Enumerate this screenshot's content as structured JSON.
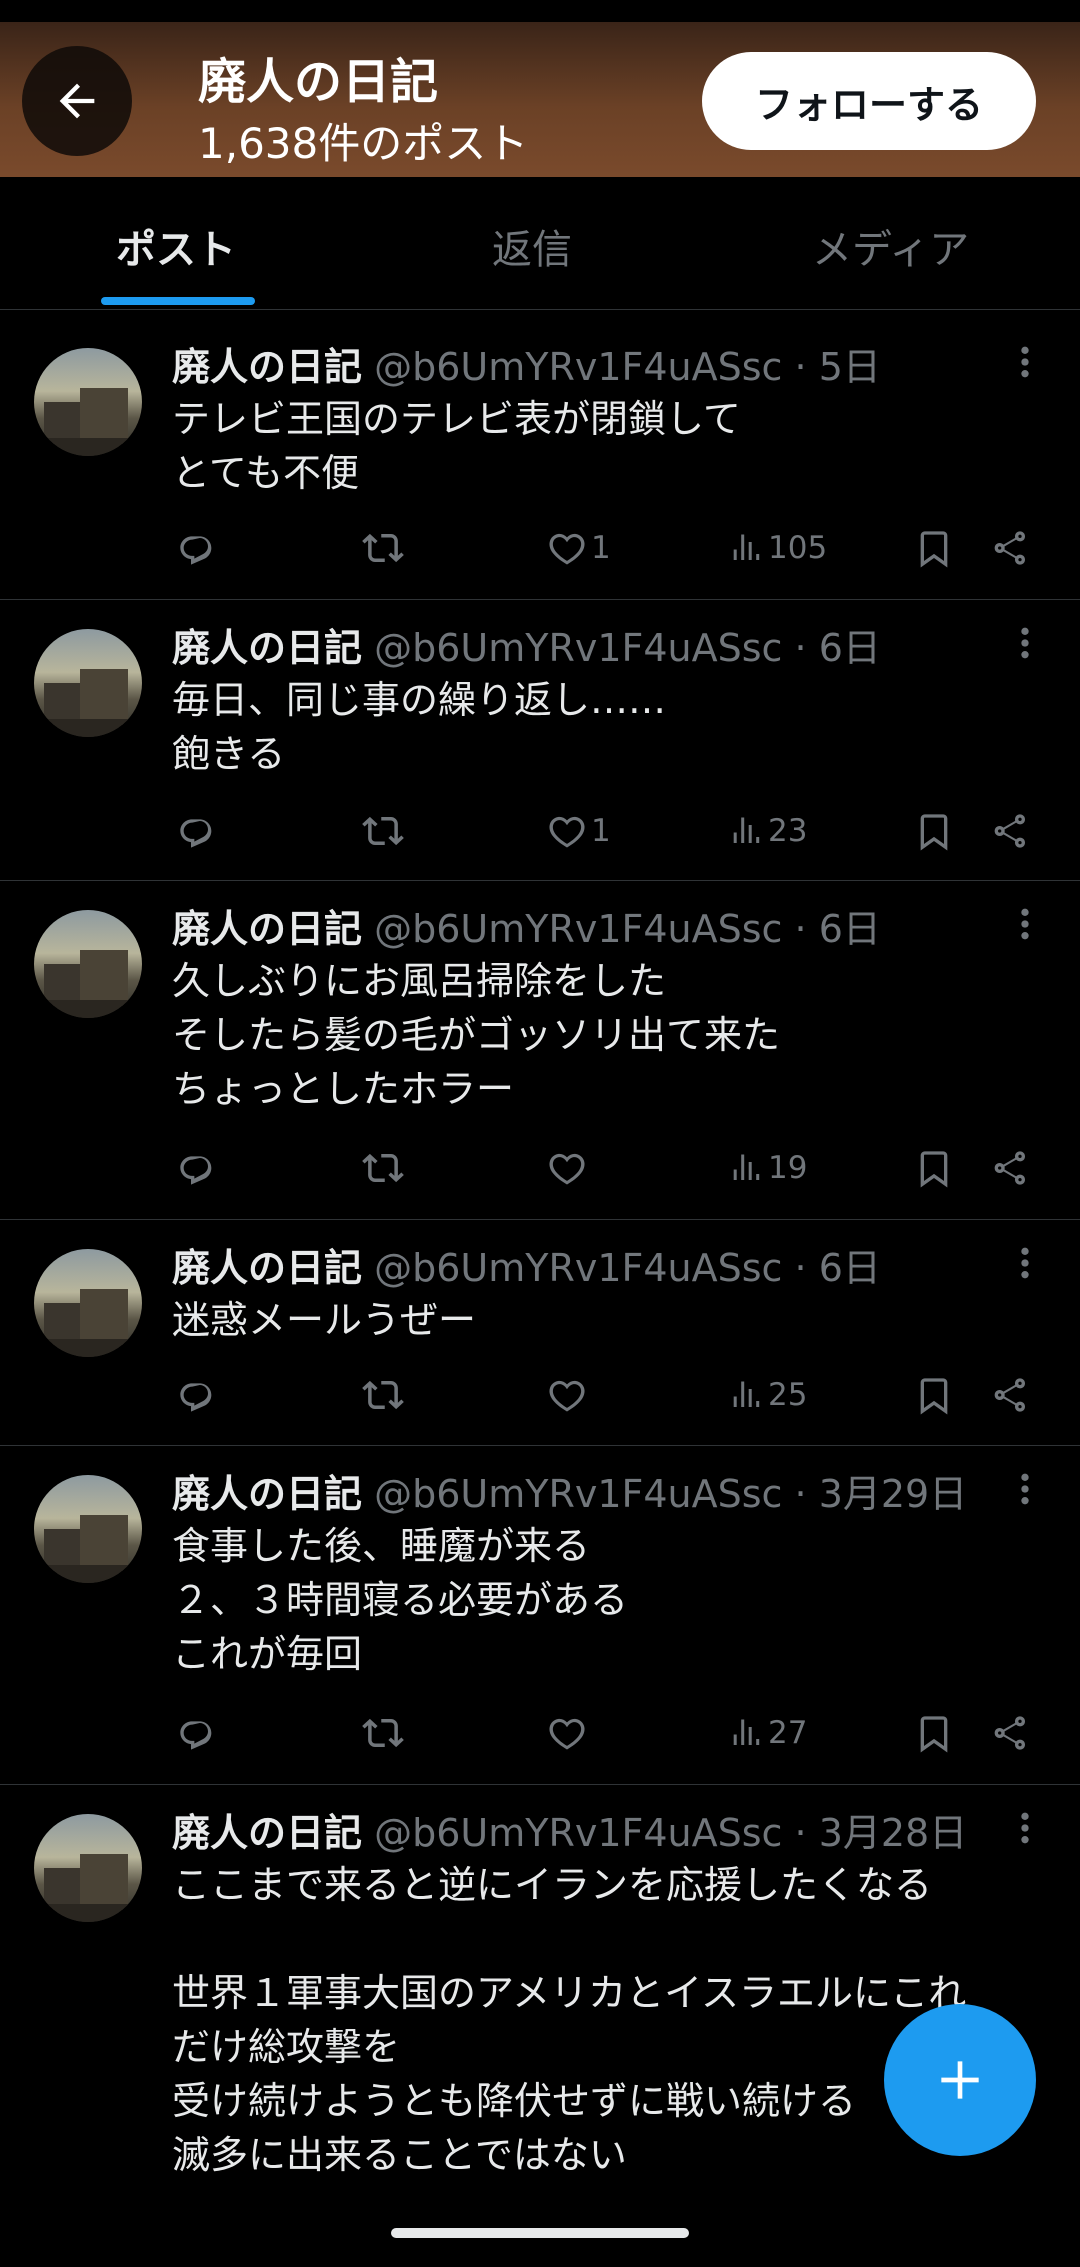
{
  "header": {
    "title": "廃人の日記",
    "post_count": "1,638件のポスト",
    "follow_label": "フォローする"
  },
  "tabs": [
    {
      "label": "ポスト",
      "active": true
    },
    {
      "label": "返信",
      "active": false
    },
    {
      "label": "メディア",
      "active": false
    }
  ],
  "colors": {
    "accent": "#1d9bf0",
    "background": "#000000",
    "muted": "#71767b"
  },
  "posts": [
    {
      "name": "廃人の日記",
      "handle": "@b6UmYRv1F4uASsc",
      "time": "· 5日",
      "text": "テレビ王国のテレビ表が閉鎖して\nとても不便",
      "likes": "1",
      "views": "105"
    },
    {
      "name": "廃人の日記",
      "handle": "@b6UmYRv1F4uASsc",
      "time": "· 6日",
      "text": "毎日、同じ事の繰り返し……\n飽きる",
      "likes": "1",
      "views": "23"
    },
    {
      "name": "廃人の日記",
      "handle": "@b6UmYRv1F4uASsc",
      "time": "· 6日",
      "text": "久しぶりにお風呂掃除をした\nそしたら髪の毛がゴッソリ出て来た\nちょっとしたホラー",
      "likes": "",
      "views": "19"
    },
    {
      "name": "廃人の日記",
      "handle": "@b6UmYRv1F4uASsc",
      "time": "· 6日",
      "text": "迷惑メールうぜー",
      "likes": "",
      "views": "25"
    },
    {
      "name": "廃人の日記",
      "handle": "@b6UmYRv1F4uASsc",
      "time": "· 3月29日",
      "text": "食事した後、睡魔が来る\n２、３時間寝る必要がある\nこれが毎回",
      "likes": "",
      "views": "27"
    },
    {
      "name": "廃人の日記",
      "handle": "@b6UmYRv1F4uASsc",
      "time": "· 3月28日",
      "text": "ここまで来ると逆にイランを応援したくなる\n\n世界１軍事大国のアメリカとイスラエルにこれ\nだけ総攻撃を\n受け続けようとも降伏せずに戦い続ける\n滅多に出来ることではない",
      "likes": "",
      "views": ""
    }
  ],
  "fab": {
    "icon": "plus-icon"
  }
}
